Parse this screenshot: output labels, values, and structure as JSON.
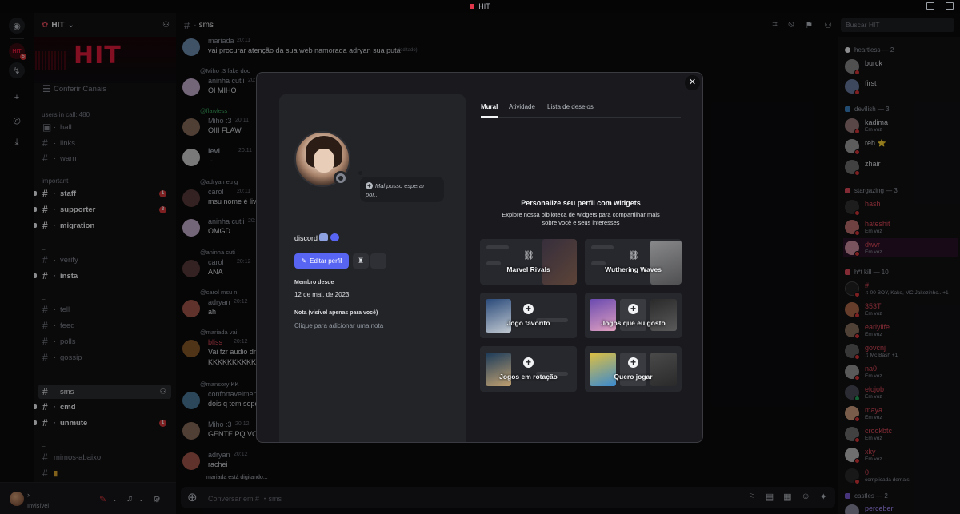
{
  "window": {
    "title": "HIT"
  },
  "server": {
    "name": "HIT",
    "banner_text": "HIT",
    "browse_label": "Conferir Canais",
    "rail_badge": "5"
  },
  "channels": {
    "cat_calls": "users in call: 480",
    "hall": "hall",
    "links": "links",
    "warn": "warn",
    "cat_important": "important",
    "staff": "staff",
    "supporter": "supporter",
    "migration": "migration",
    "verify": "verify",
    "insta": "insta",
    "tell": "tell",
    "feed": "feed",
    "polls": "polls",
    "gossip": "gossip",
    "sms": "sms",
    "cmd": "cmd",
    "unmute": "unmute",
    "mimos": "mimos-abaixo",
    "badge_staff": "1",
    "badge_supporter": "3",
    "badge_unmute": "1",
    "dash": "_"
  },
  "user_panel": {
    "status": "Invisível"
  },
  "chat": {
    "channel": "sms",
    "search_placeholder": "Buscar HIT",
    "composer_placeholder": "Conversar em # ・sms",
    "typing": "mariada está digitando...",
    "messages": [
      {
        "name": "mariada",
        "time": "20:11",
        "text": "vai procurar atenção da sua web namorada adryan sua puta",
        "edited": "(editado)"
      },
      {
        "reply": "@Miho :3 fake doo",
        "name": "aninha cutii",
        "time": "20:11",
        "text": "OI MIHO"
      },
      {
        "reply": "@flawless",
        "name": "Miho :3",
        "time": "20:11",
        "text": "OIII FLAW"
      },
      {
        "name": "levi",
        "time": "20:11",
        "text": "·-·"
      },
      {
        "reply": "@adryan eu g",
        "name": "carol",
        "time": "20:11",
        "text": "msu nome é livi"
      },
      {
        "name": "aninha cutii",
        "time": "20:12",
        "text": "OMGD"
      },
      {
        "reply": "@aninha cuti",
        "name": "carol",
        "time": "20:12",
        "text": "ANA"
      },
      {
        "reply": "@carol msu n",
        "name": "adryan",
        "time": "20:12",
        "text": "ah"
      },
      {
        "reply": "@mariada vai",
        "name": "bliss",
        "time": "20:12",
        "text": "Vai fzr audio dn",
        "text2": "KKKKKKKKKKK"
      },
      {
        "reply": "@mansory KK",
        "name": "confortavelmen",
        "time": "",
        "text": "dois q tem sepe"
      },
      {
        "name": "Miho :3",
        "time": "20:12",
        "text": "GENTE PQ VCS"
      },
      {
        "name": "adryan",
        "time": "20:12",
        "text": "rachei"
      }
    ]
  },
  "members": {
    "groups": [
      {
        "label": "heartless — 2",
        "color": "#f2f3f5"
      },
      {
        "label": "devilish — 3",
        "color": "#3b82c4"
      },
      {
        "label": "stargazing — 3",
        "color": "#e04a5a"
      },
      {
        "label": "h*t kill — 10",
        "color": "#e04a5a"
      },
      {
        "label": "castles — 2",
        "color": "#7b5bd6"
      }
    ],
    "list": [
      {
        "name": "burck",
        "sub": ""
      },
      {
        "name": "first",
        "sub": ""
      },
      {
        "name": "kadima",
        "sub": "Em voz"
      },
      {
        "name": "reh ⭐",
        "sub": ""
      },
      {
        "name": "zhair",
        "sub": ""
      },
      {
        "name": "hash",
        "sub": ""
      },
      {
        "name": "hateshit",
        "sub": "Em voz"
      },
      {
        "name": "dwvr",
        "sub": "Em voz"
      },
      {
        "name": "#",
        "sub": "♫ 00 BOY, Kako, MC Jakezinho...+1"
      },
      {
        "name": "353T",
        "sub": "Em voz"
      },
      {
        "name": "earlylife",
        "sub": "Em voz"
      },
      {
        "name": "govcnj",
        "sub": "♫ Mc Bash +1"
      },
      {
        "name": "na0",
        "sub": "Em voz"
      },
      {
        "name": "elojob",
        "sub": "Em voz"
      },
      {
        "name": "maya",
        "sub": "Em voz"
      },
      {
        "name": "crookbtc",
        "sub": "Em voz"
      },
      {
        "name": "xky",
        "sub": "Em voz"
      },
      {
        "name": "0",
        "sub": "complicada demais"
      },
      {
        "name": "perceber",
        "sub": ""
      }
    ]
  },
  "profile": {
    "close": "✕",
    "custom_status": "Mal posso esperar por...",
    "username": "discord",
    "edit_button": "Editar perfil",
    "more": "···",
    "member_since_label": "Membro desde",
    "member_since": "12 de mai. de 2023",
    "note_label": "Nota (visível apenas para você)",
    "note_placeholder": "Clique para adicionar uma nota",
    "tabs": [
      "Mural",
      "Atividade",
      "Lista de desejos"
    ],
    "widgets_title": "Personalize seu perfil com widgets",
    "widgets_subtitle": "Explore nossa biblioteca de widgets para compartilhar mais sobre você e seus interesses",
    "widgets": [
      "Marvel Rivals",
      "Wuthering Waves",
      "Jogo favorito",
      "Jogos que eu gosto",
      "Jogos em rotação",
      "Quero jogar"
    ]
  }
}
